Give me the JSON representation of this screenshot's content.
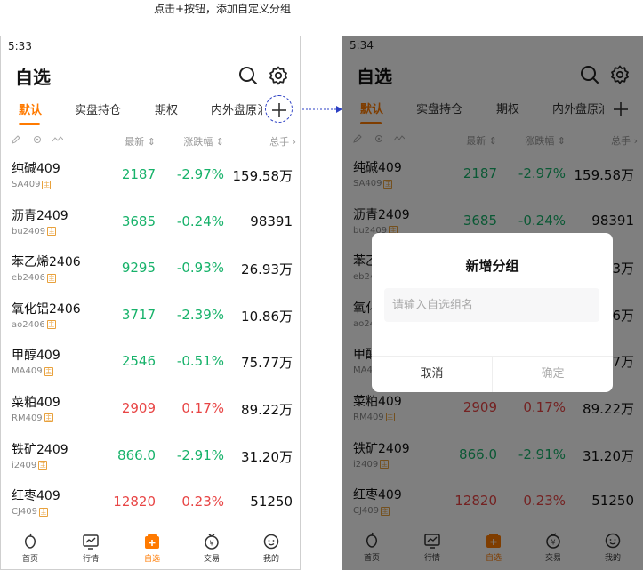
{
  "caption": "点击+按钮，添加自定义分组",
  "status_time_left": "5:33",
  "status_time_right": "5:34",
  "page_title": "自选",
  "tabs": [
    "默认",
    "实盘持仓",
    "期权",
    "内外盘原油"
  ],
  "columns": [
    "最新",
    "涨跌幅",
    "总手"
  ],
  "rows": [
    {
      "name": "纯碱409",
      "code": "SA409",
      "last": "2187",
      "change": "-2.97%",
      "volume": "159.58万",
      "dir": "down"
    },
    {
      "name": "沥青2409",
      "code": "bu2409",
      "last": "3685",
      "change": "-0.24%",
      "volume": "98391",
      "dir": "down"
    },
    {
      "name": "苯乙烯2406",
      "code": "eb2406",
      "last": "9295",
      "change": "-0.93%",
      "volume": "26.93万",
      "dir": "down"
    },
    {
      "name": "氧化铝2406",
      "code": "ao2406",
      "last": "3717",
      "change": "-2.39%",
      "volume": "10.86万",
      "dir": "down"
    },
    {
      "name": "甲醇409",
      "code": "MA409",
      "last": "2546",
      "change": "-0.51%",
      "volume": "75.77万",
      "dir": "down"
    },
    {
      "name": "菜粕409",
      "code": "RM409",
      "last": "2909",
      "change": "0.17%",
      "volume": "89.22万",
      "dir": "up"
    },
    {
      "name": "铁矿2409",
      "code": "i2409",
      "last": "866.0",
      "change": "-2.91%",
      "volume": "31.20万",
      "dir": "down"
    },
    {
      "name": "红枣409",
      "code": "CJ409",
      "last": "12820",
      "change": "0.23%",
      "volume": "51250",
      "dir": "up"
    }
  ],
  "badge_char": "主",
  "bottom_nav": [
    "首页",
    "行情",
    "自选",
    "交易",
    "我的"
  ],
  "dialog": {
    "title": "新增分组",
    "placeholder": "请输入自选组名",
    "cancel": "取消",
    "confirm": "确定"
  },
  "colors": {
    "accent": "#ff7a00",
    "down": "#17b26a",
    "up": "#e84545",
    "annotation": "#2b3fc4"
  }
}
